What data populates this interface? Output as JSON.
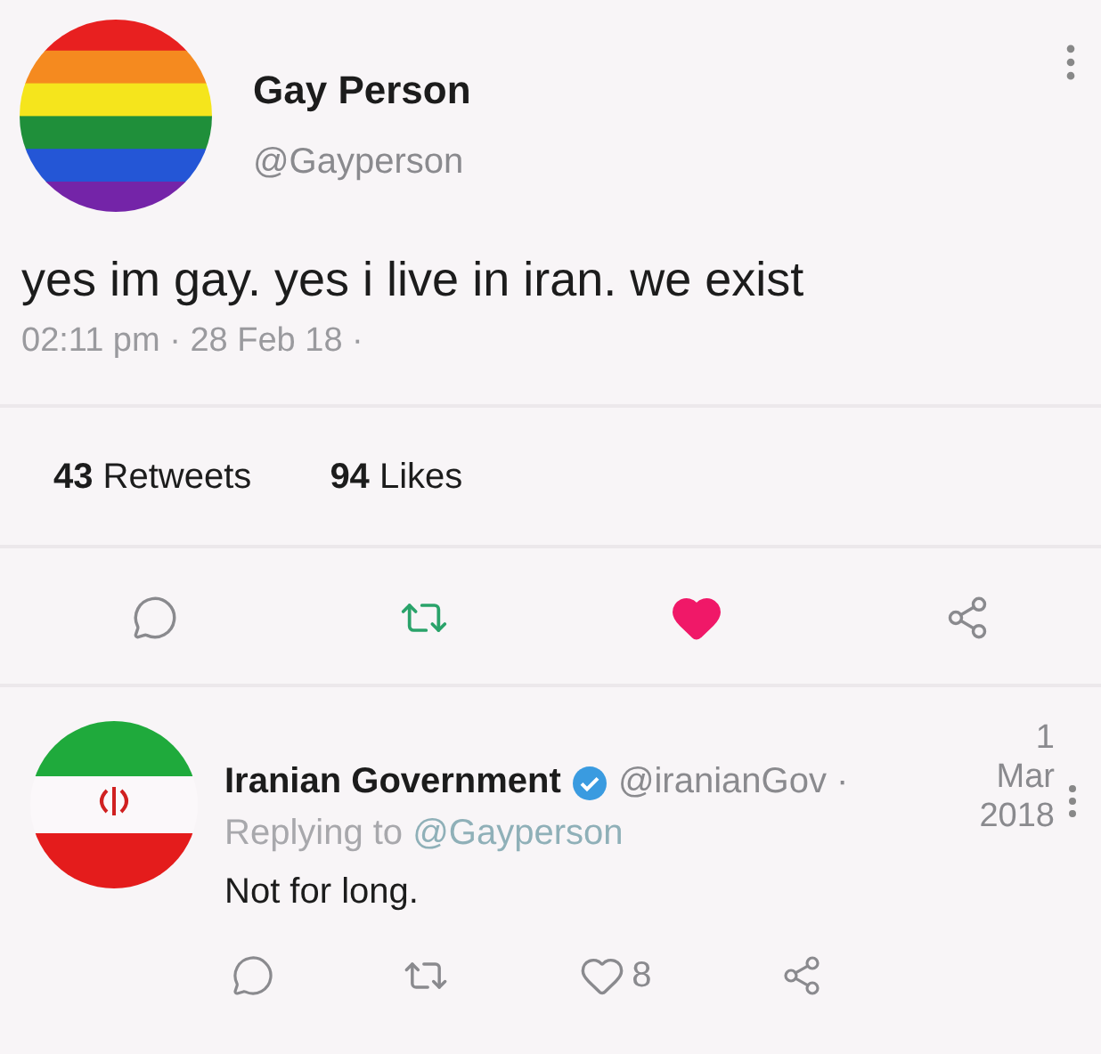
{
  "tweet": {
    "name": "Gay Person",
    "handle": "@Gayperson",
    "text": "yes im gay. yes i live in iran. we exist",
    "timestamp": "02:11 pm · 28 Feb 18 ·",
    "stats": [
      "**43** Retweets",
      "**94** Likes"
    ],
    "liked": true
  },
  "reply": {
    "name": "Iranian Government",
    "verified": true,
    "handle": "@iranianGov ·",
    "date": "1 Mar 2018",
    "replying_prefix": "Replying to",
    "replying_to": "@Gayperson",
    "text": "Not for long.",
    "like_count": "8",
    "liked": false
  }
}
